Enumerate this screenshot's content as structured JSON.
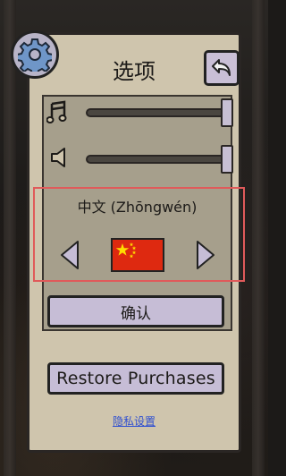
{
  "header": {
    "title": "选项",
    "settings_icon": "gear-icon",
    "back_icon": "back-arrow-icon"
  },
  "audio": {
    "music_icon": "music-note-icon",
    "music_volume": 1.0,
    "sound_icon": "speaker-icon",
    "sound_volume": 1.0
  },
  "language": {
    "current": "中文 (Zhōngwén)",
    "prev_icon": "triangle-left-icon",
    "next_icon": "triangle-right-icon",
    "flag": "china-flag-icon"
  },
  "buttons": {
    "confirm_label": "确认",
    "restore_label": "Restore Purchases",
    "privacy_label": "隐私设置"
  },
  "colors": {
    "panel": "#cfc5ad",
    "inner_panel": "#a69f8c",
    "button": "#c6bdd6",
    "highlight": "#e05a5a",
    "link": "#3050d0",
    "flag_red": "#de2910",
    "flag_yellow": "#ffde00"
  }
}
